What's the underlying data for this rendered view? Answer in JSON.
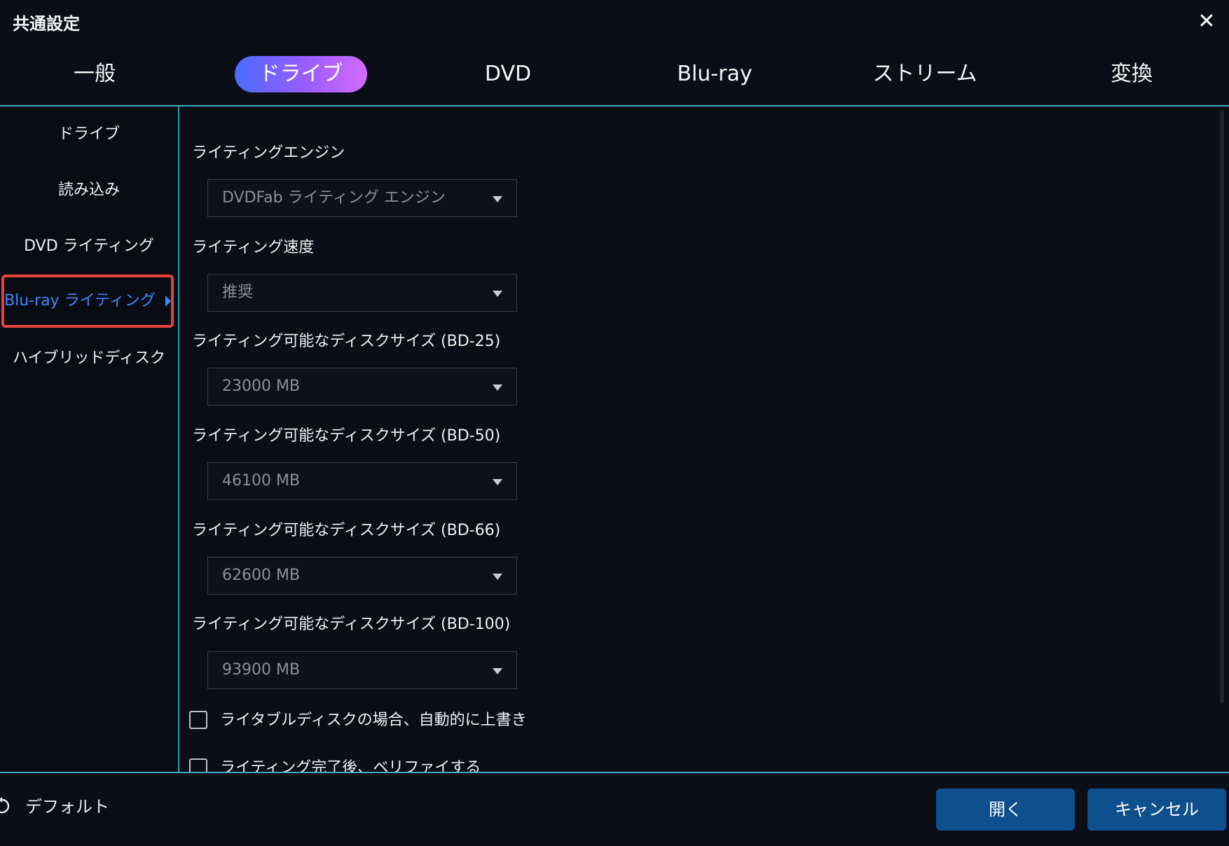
{
  "window": {
    "title": "共通設定",
    "close_symbol": "✕"
  },
  "tabs": [
    {
      "label": "一般",
      "active": false
    },
    {
      "label": "ドライブ",
      "active": true
    },
    {
      "label": "DVD",
      "active": false
    },
    {
      "label": "Blu-ray",
      "active": false
    },
    {
      "label": "ストリーム",
      "active": false
    },
    {
      "label": "変換",
      "active": false
    }
  ],
  "sidebar": {
    "items": [
      {
        "label": "ドライブ",
        "active": false
      },
      {
        "label": "読み込み",
        "active": false
      },
      {
        "label": "DVD ライティング",
        "active": false
      },
      {
        "label": "Blu-ray ライティング",
        "active": true
      },
      {
        "label": "ハイブリッドディスク",
        "active": false
      }
    ]
  },
  "settings": {
    "engine": {
      "label": "ライティングエンジン",
      "value": "DVDFab ライティング エンジン"
    },
    "speed": {
      "label": "ライティング速度",
      "value": "推奨"
    },
    "bd25": {
      "label": "ライティング可能なディスクサイズ (BD-25)",
      "value": "23000 MB"
    },
    "bd50": {
      "label": "ライティング可能なディスクサイズ (BD-50)",
      "value": "46100 MB"
    },
    "bd66": {
      "label": "ライティング可能なディスクサイズ (BD-66)",
      "value": "62600 MB"
    },
    "bd100": {
      "label": "ライティング可能なディスクサイズ (BD-100)",
      "value": "93900 MB"
    },
    "overwrite": {
      "label": "ライタブルディスクの場合、自動的に上書き",
      "checked": false
    },
    "verify": {
      "label": "ライティング完了後、ベリファイする",
      "checked": false
    }
  },
  "footer": {
    "default_label": "デフォルト",
    "open_label": "開く",
    "cancel_label": "キャンセル"
  },
  "colors": {
    "accent_gradient_start": "#4a6bff",
    "accent_gradient_end": "#d36bff",
    "active_sidebar_text": "#3d86ff",
    "highlight_border": "#e3423c",
    "button_bg": "#0e4f8e",
    "divider": "#3fa8c5"
  },
  "icons": {
    "close": "close-icon",
    "dropdown": "chevron-down-icon",
    "active_item": "triangle-right-icon",
    "reset": "reset-icon"
  }
}
